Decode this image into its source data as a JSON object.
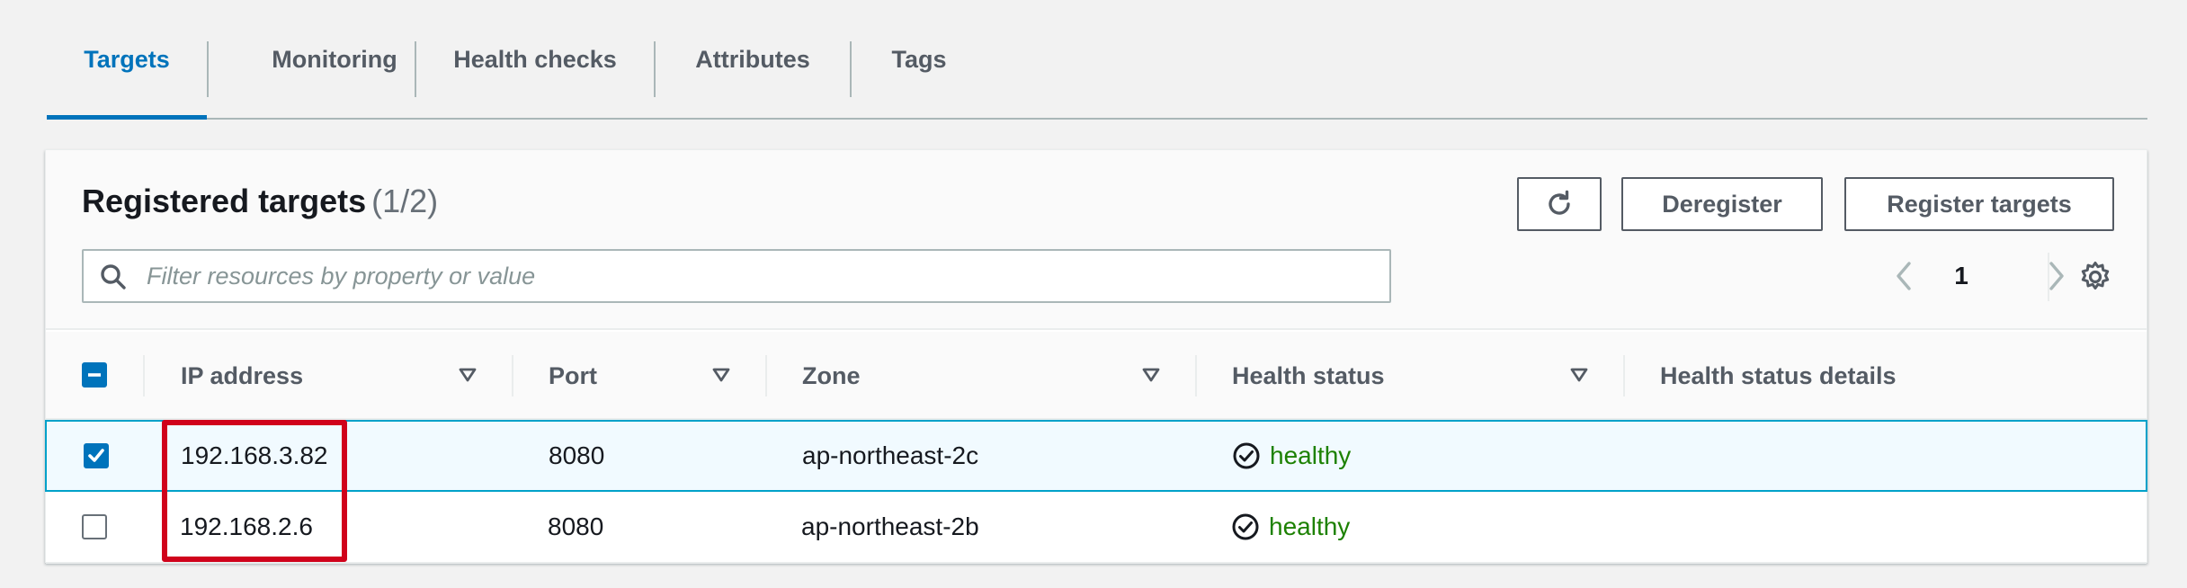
{
  "tabs": [
    {
      "label": "Targets",
      "active": true
    },
    {
      "label": "Monitoring",
      "active": false
    },
    {
      "label": "Health checks",
      "active": false
    },
    {
      "label": "Attributes",
      "active": false
    },
    {
      "label": "Tags",
      "active": false
    }
  ],
  "panel": {
    "title": "Registered targets",
    "count": "(1/2)"
  },
  "actions": {
    "refresh_icon": "refresh-icon",
    "deregister_label": "Deregister",
    "register_label": "Register targets"
  },
  "search": {
    "placeholder": "Filter resources by property or value",
    "value": ""
  },
  "pagination": {
    "current_page": "1"
  },
  "table": {
    "columns": [
      "IP address",
      "Port",
      "Zone",
      "Health status",
      "Health status details"
    ],
    "rows": [
      {
        "selected": true,
        "ip": "192.168.3.82",
        "port": "8080",
        "zone": "ap-northeast-2c",
        "health": "healthy",
        "details": ""
      },
      {
        "selected": false,
        "ip": "192.168.2.6",
        "port": "8080",
        "zone": "ap-northeast-2b",
        "health": "healthy",
        "details": ""
      }
    ]
  },
  "colors": {
    "accent": "#0073bb",
    "healthy": "#1d8102",
    "selection_border": "#00a1c9",
    "annotation": "#d0021b"
  }
}
